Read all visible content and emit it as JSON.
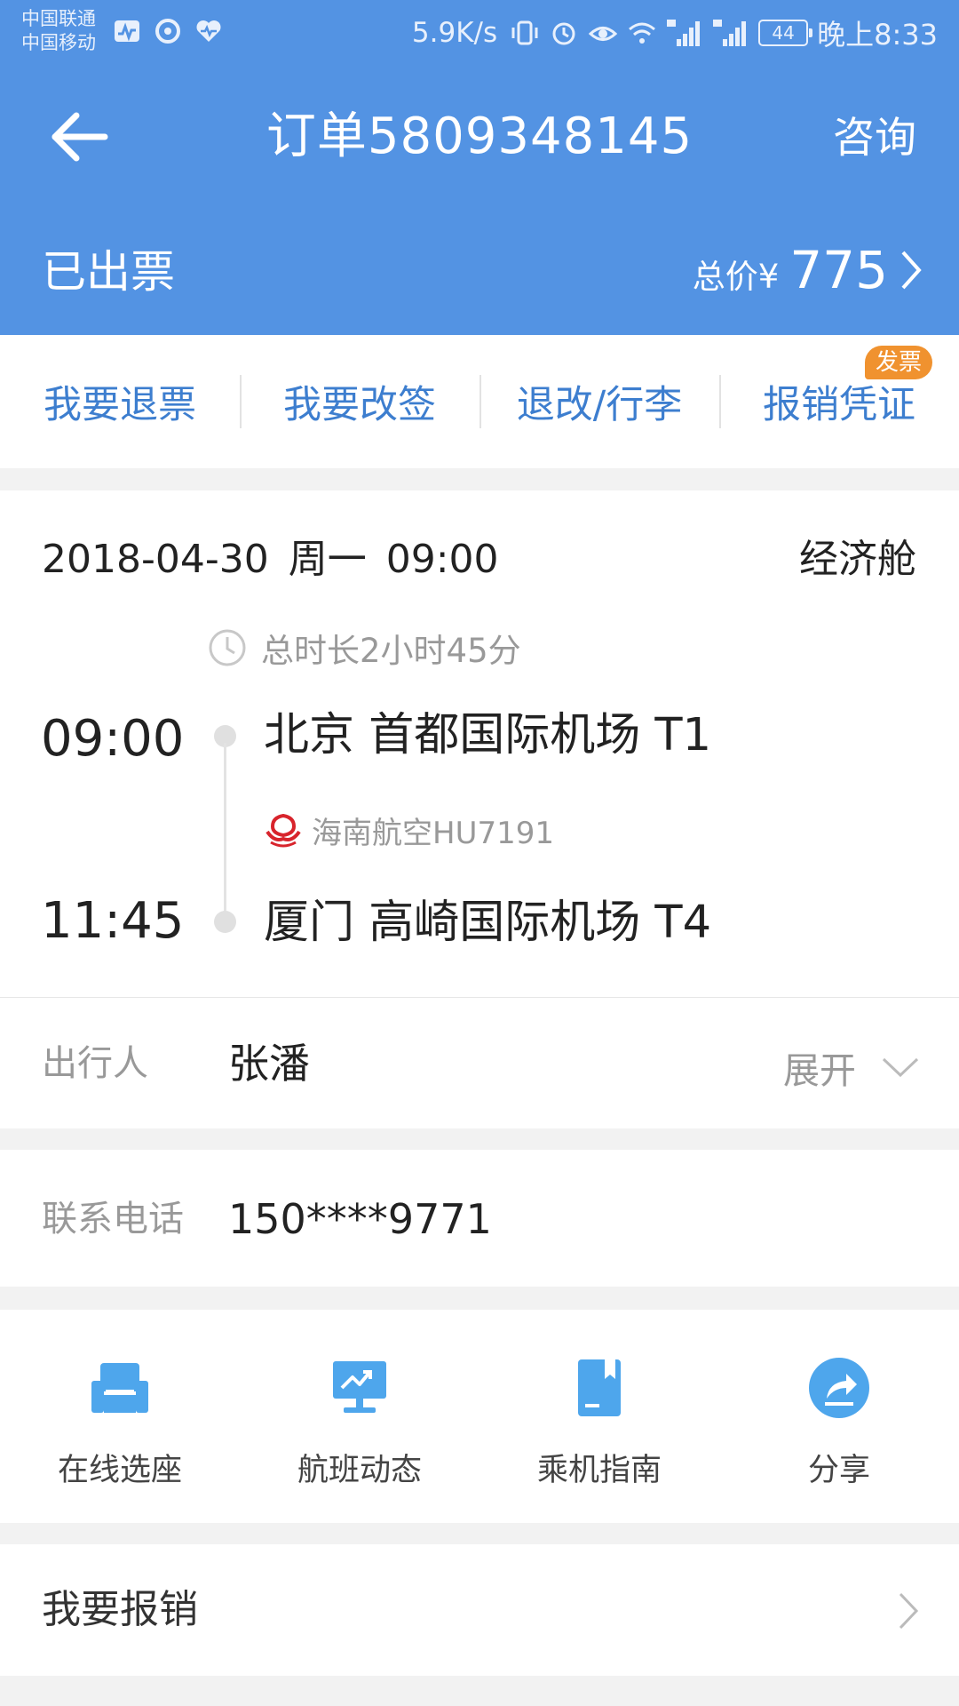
{
  "status_bar": {
    "carrier_1": "中国联通",
    "carrier_2": "中国移动",
    "net_speed": "5.9K/s",
    "battery": "44",
    "time": "晚上8:33"
  },
  "nav": {
    "title": "订单5809348145",
    "consult_label": "咨询"
  },
  "order": {
    "status": "已出票",
    "price_label": "总价¥",
    "price_value": "775"
  },
  "actions": [
    {
      "label": "我要退票"
    },
    {
      "label": "我要改签"
    },
    {
      "label": "退改/行李"
    },
    {
      "label": "报销凭证",
      "badge": "发票"
    }
  ],
  "flight": {
    "date": "2018-04-30",
    "weekday": "周一",
    "dep_time_header": "09:00",
    "cabin": "经济舱",
    "duration": "总时长2小时45分",
    "departure": {
      "time": "09:00",
      "airport": "北京 首都国际机场 T1"
    },
    "airline": "海南航空HU7191",
    "arrival": {
      "time": "11:45",
      "airport": "厦门 高崎国际机场 T4"
    }
  },
  "traveler": {
    "label": "出行人",
    "name": "张潘",
    "expand_label": "展开"
  },
  "contact": {
    "label": "联系电话",
    "phone": "150****9771"
  },
  "services": [
    {
      "label": "在线选座",
      "icon": "seat-icon"
    },
    {
      "label": "航班动态",
      "icon": "flight-status-icon"
    },
    {
      "label": "乘机指南",
      "icon": "guide-book-icon"
    },
    {
      "label": "分享",
      "icon": "share-icon"
    }
  ],
  "reimburse": {
    "label": "我要报销"
  },
  "colors": {
    "header_bg": "#5393e3",
    "action_text": "#3d7ecf",
    "badge_bg": "#f0922f",
    "icon_blue": "#4ea6ec",
    "airline_red": "#d8242c"
  }
}
